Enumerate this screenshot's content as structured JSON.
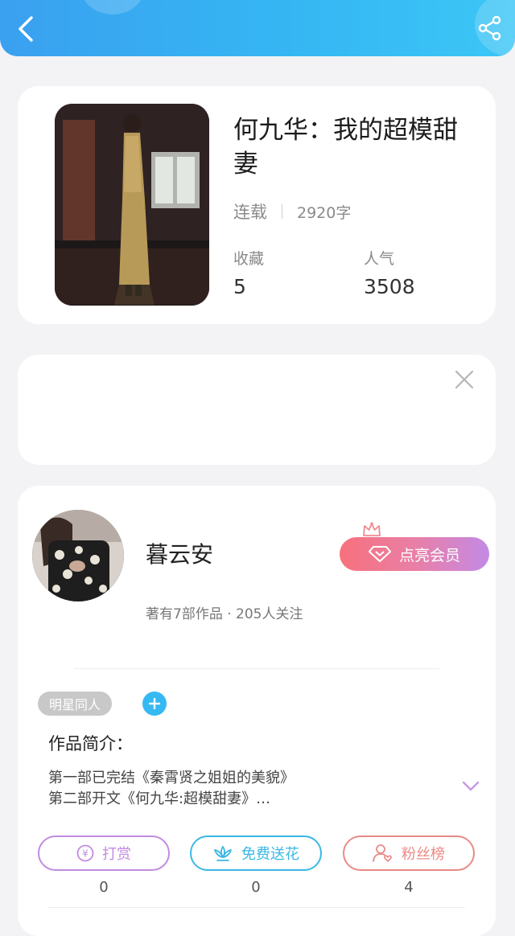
{
  "colors": {
    "header_gradient_start": "#3aa0f0",
    "header_gradient_end": "#3cc6f6",
    "reward": "#c18be0",
    "flower": "#3ab8e4",
    "fans": "#e98a86",
    "vip_start": "#f7717c",
    "vip_end": "#c38ae6"
  },
  "header": {
    "back_icon": "chevron-left-icon",
    "share_icon": "share-icon"
  },
  "book": {
    "title": "何九华：我的超模甜妻",
    "status": "连载",
    "word_count": "2920字",
    "favorites_label": "收藏",
    "favorites_value": "5",
    "popularity_label": "人气",
    "popularity_value": "3508"
  },
  "ad": {
    "close_icon": "close-icon"
  },
  "author": {
    "name": "暮云安",
    "vip_label": "点亮会员",
    "stats": "著有7部作品 · 205人关注",
    "tag": "明星同人",
    "intro_label": "作品简介：",
    "intro_line1": "第一部已完结《秦霄贤之姐姐的美貌》",
    "intro_line2": "第二部开文《何九华:超模甜妻》…"
  },
  "actions": [
    {
      "label": "打赏",
      "count": "0",
      "icon": "yen-coin-icon"
    },
    {
      "label": "免费送花",
      "count": "0",
      "icon": "lotus-flower-icon"
    },
    {
      "label": "粉丝榜",
      "count": "4",
      "icon": "fan-user-icon"
    }
  ]
}
